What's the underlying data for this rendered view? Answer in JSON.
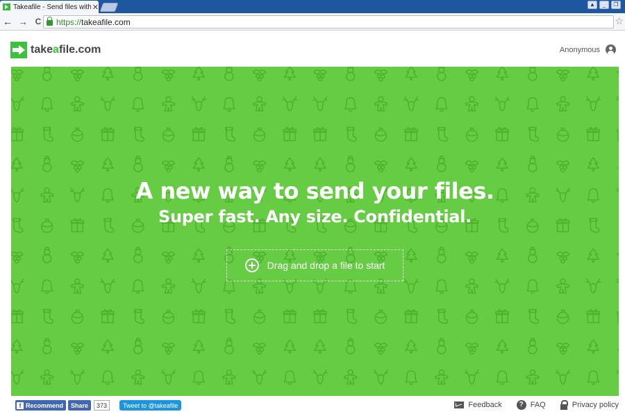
{
  "browser": {
    "tab_title": "Takeafile - Send files without",
    "tab_close": "✕",
    "url_scheme": "https://",
    "url_host": "takeafile.com",
    "back": "←",
    "forward": "→",
    "reload": "C",
    "bookmark": "☆",
    "window_buttons": [
      "▲",
      "_",
      "❐"
    ]
  },
  "header": {
    "logo_prefix": "take",
    "logo_accent": "a",
    "logo_suffix": "file.com",
    "account_label": "Anonymous"
  },
  "hero": {
    "title": "A new way to send your files.",
    "subtitle": "Super fast. Any size. Confidential.",
    "dropzone_label": "Drag and drop a file to start",
    "pattern_icons": [
      "christmas-tree",
      "snowman",
      "holly",
      "bell",
      "gingerbread-man",
      "reindeer",
      "gift",
      "stocking",
      "ornament"
    ]
  },
  "footer": {
    "recommend_label": "Recommend",
    "share_label": "Share",
    "share_count": "373",
    "tweet_label": "Tweet to @takeafile",
    "feedback_label": "Feedback",
    "faq_label": "FAQ",
    "privacy_label": "Privacy policy"
  },
  "colors": {
    "brand_green": "#3cc23c",
    "hero_green": "#66cc44",
    "pattern_stroke": "#4cb32f"
  }
}
